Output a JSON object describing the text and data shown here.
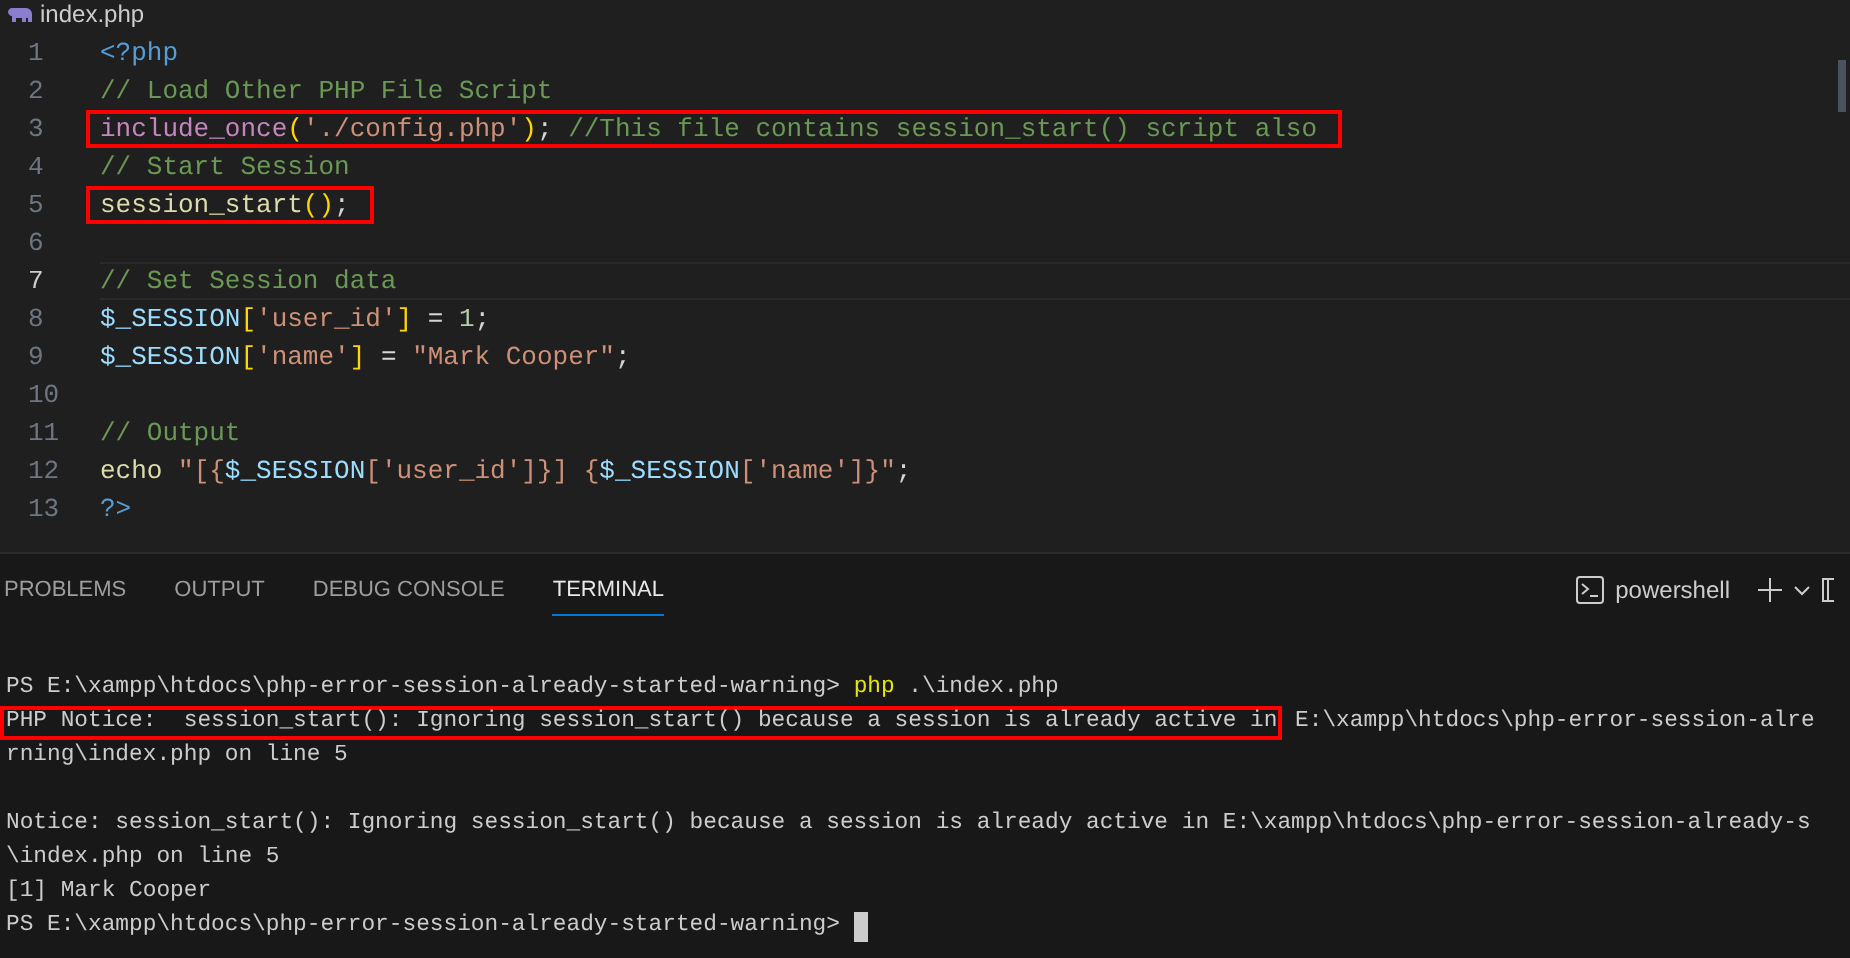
{
  "editor_tab": {
    "title": "index.php"
  },
  "code_lines": [
    {
      "number": "1",
      "current": false,
      "highlighted": false,
      "tokens": [
        {
          "kind": "tag",
          "text": "<?php"
        }
      ]
    },
    {
      "number": "2",
      "current": false,
      "highlighted": false,
      "tokens": [
        {
          "kind": "comment",
          "text": "// Load Other PHP File Script"
        }
      ]
    },
    {
      "number": "3",
      "current": false,
      "highlighted": true,
      "tokens": [
        {
          "kind": "keyword",
          "text": "include_once"
        },
        {
          "kind": "bracket",
          "text": "("
        },
        {
          "kind": "string",
          "text": "'./config.php'"
        },
        {
          "kind": "bracket",
          "text": ")"
        },
        {
          "kind": "punct",
          "text": "; "
        },
        {
          "kind": "comment",
          "text": "//This file contains session_start() script also"
        }
      ]
    },
    {
      "number": "4",
      "current": false,
      "highlighted": false,
      "tokens": [
        {
          "kind": "comment",
          "text": "// Start Session"
        }
      ]
    },
    {
      "number": "5",
      "current": false,
      "highlighted": true,
      "tokens": [
        {
          "kind": "function",
          "text": "session_start"
        },
        {
          "kind": "bracket",
          "text": "()"
        },
        {
          "kind": "punct",
          "text": ";"
        }
      ]
    },
    {
      "number": "6",
      "current": false,
      "highlighted": false
    },
    {
      "number": "7",
      "current": true,
      "highlighted": false,
      "tokens": [
        {
          "kind": "comment",
          "text": "// Set Session data"
        }
      ]
    },
    {
      "number": "8",
      "current": false,
      "highlighted": false,
      "tokens": [
        {
          "kind": "variable",
          "text": "$_SESSION"
        },
        {
          "kind": "bracket",
          "text": "["
        },
        {
          "kind": "string",
          "text": "'user_id'"
        },
        {
          "kind": "bracket",
          "text": "]"
        },
        {
          "kind": "punct",
          "text": " = "
        },
        {
          "kind": "number",
          "text": "1"
        },
        {
          "kind": "punct",
          "text": ";"
        }
      ]
    },
    {
      "number": "9",
      "current": false,
      "highlighted": false,
      "tokens": [
        {
          "kind": "variable",
          "text": "$_SESSION"
        },
        {
          "kind": "bracket",
          "text": "["
        },
        {
          "kind": "string",
          "text": "'name'"
        },
        {
          "kind": "bracket",
          "text": "]"
        },
        {
          "kind": "punct",
          "text": " = "
        },
        {
          "kind": "string",
          "text": "\"Mark Cooper\""
        },
        {
          "kind": "punct",
          "text": ";"
        }
      ]
    },
    {
      "number": "10",
      "current": false,
      "highlighted": false
    },
    {
      "number": "11",
      "current": false,
      "highlighted": false,
      "tokens": [
        {
          "kind": "comment",
          "text": "// Output"
        }
      ]
    },
    {
      "number": "12",
      "current": false,
      "highlighted": false,
      "tokens": [
        {
          "kind": "function",
          "text": "echo "
        },
        {
          "kind": "string",
          "text": "\"[{"
        },
        {
          "kind": "variable",
          "text": "$_SESSION"
        },
        {
          "kind": "string",
          "text": "['user_id']}] {"
        },
        {
          "kind": "variable",
          "text": "$_SESSION"
        },
        {
          "kind": "string",
          "text": "['name']}\""
        },
        {
          "kind": "punct",
          "text": ";"
        }
      ]
    },
    {
      "number": "13",
      "current": false,
      "highlighted": false,
      "tokens": [
        {
          "kind": "tag",
          "text": "?>"
        }
      ]
    }
  ],
  "panel_tabs": [
    {
      "label": "PROBLEMS",
      "selected": false
    },
    {
      "label": "OUTPUT",
      "selected": false
    },
    {
      "label": "DEBUG CONSOLE",
      "selected": false
    },
    {
      "label": "TERMINAL",
      "selected": true
    }
  ],
  "terminal_profile": "powershell",
  "terminal_lines": [
    {
      "segments": [
        {
          "text": "PS E:\\xampp\\htdocs\\php-error-session-already-started-warning> ",
          "kind": "plain"
        },
        {
          "text": "php",
          "kind": "command"
        },
        {
          "text": " .\\index.php",
          "kind": "plain"
        }
      ]
    },
    {
      "segments": [
        {
          "text": "PHP Notice:  session_start(): Ignoring session_start() because a session is already active in",
          "kind": "highlighted"
        },
        {
          "text": " E:\\xampp\\htdocs\\php-error-session-alre",
          "kind": "plain"
        }
      ]
    },
    {
      "segments": [
        {
          "text": "rning\\index.php on line 5",
          "kind": "plain"
        }
      ]
    },
    {
      "blank_line_before": true,
      "segments": [
        {
          "text": "Notice: session_start(): Ignoring session_start() because a session is already active in E:\\xampp\\htdocs\\php-error-session-already-s",
          "kind": "plain"
        }
      ]
    },
    {
      "segments": [
        {
          "text": "\\index.php on line 5",
          "kind": "plain"
        }
      ]
    },
    {
      "segments": [
        {
          "text": "[1] Mark Cooper",
          "kind": "plain"
        }
      ]
    },
    {
      "segments": [
        {
          "text": "PS E:\\xampp\\htdocs\\php-error-session-already-started-warning> ",
          "kind": "plain"
        }
      ],
      "cursor": true
    }
  ]
}
